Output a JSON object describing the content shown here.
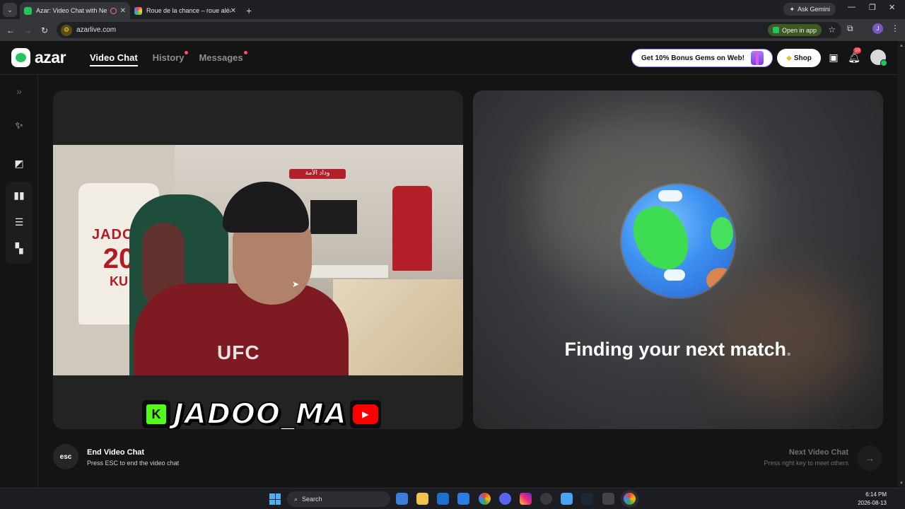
{
  "browser": {
    "tabs": [
      {
        "title": "Azar: Video Chat with New",
        "active": true
      },
      {
        "title": "Roue de la chance – roue aléat",
        "active": false
      }
    ],
    "ask_gemini": "Ask Gemini",
    "url": "azarlive.com",
    "open_in_app": "Open in app",
    "profile_initial": "J"
  },
  "header": {
    "logo_text": "azar",
    "nav": [
      {
        "label": "Video Chat",
        "active": true,
        "dot": false
      },
      {
        "label": "History",
        "active": false,
        "dot": true
      },
      {
        "label": "Messages",
        "active": false,
        "dot": true
      }
    ],
    "gems_promo": "Get 10% Bonus Gems on Web!",
    "shop_label": "Shop",
    "notification_count": "10"
  },
  "rail": {
    "icons": [
      "expand-icon",
      "magic-wand-icon",
      "filter-icon",
      "layout-side-by-side-icon",
      "layout-stacked-icon",
      "layout-grid-icon"
    ]
  },
  "left_panel": {
    "jersey_name": "JADOO",
    "jersey_number": "20",
    "jersey_extra": "KU",
    "shirt_text": "UFC",
    "scarf_text": "وداد الأمة",
    "watermark_text": "JADOO_MA",
    "watermark_k": "K"
  },
  "right_panel": {
    "status_text": "Finding your next match",
    "status_dot": "."
  },
  "footer": {
    "esc_label": "esc",
    "end_title": "End Video Chat",
    "end_subtitle": "Press ESC to end the video chat",
    "next_title": "Next Video Chat",
    "next_subtitle": "Press right key to meet others"
  },
  "taskbar": {
    "search_label": "Search",
    "time": "6:14 PM",
    "date": "2026-08-13"
  },
  "colors": {
    "accent_green": "#22c55e",
    "notification_red": "#ff3b4e",
    "background": "#141414"
  }
}
